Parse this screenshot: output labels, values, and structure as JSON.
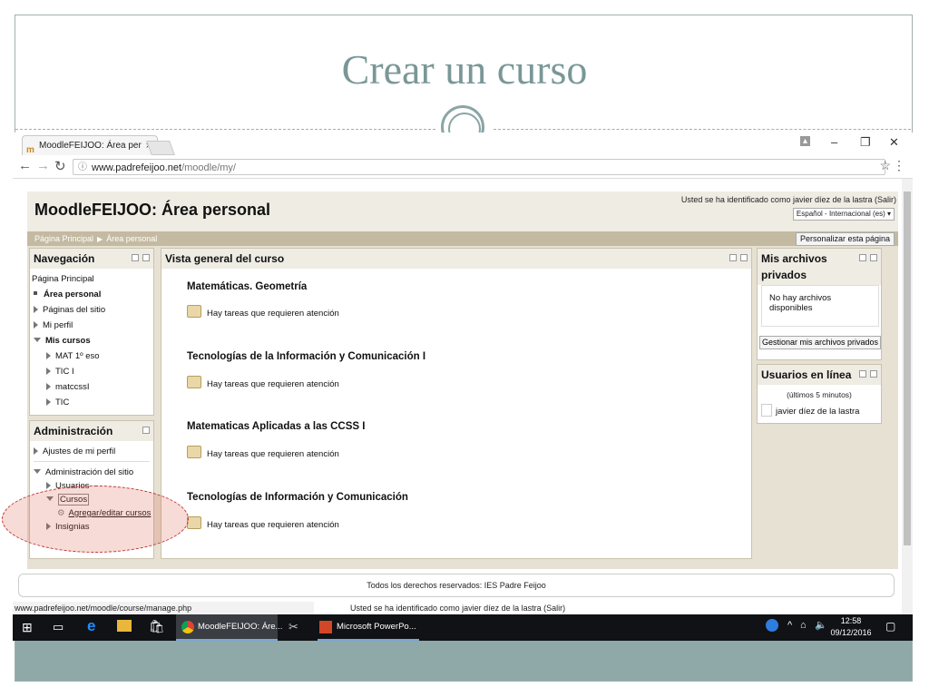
{
  "slide": {
    "title": "Crear un curso"
  },
  "browser": {
    "tab_title": "MoodleFEIJOO: Área per",
    "tab_close": "×",
    "url_host": "www.padrefeijoo.net",
    "url_path": "/moodle/my/",
    "status_url": "www.padrefeijoo.net/moodle/course/manage.php"
  },
  "moodle": {
    "site_title": "MoodleFEIJOO: Área personal",
    "login_info": "Usted se ha identificado como javier díez de la lastra (Salir)",
    "language": "Español - Internacional (es)",
    "breadcrumb": [
      "Página Principal",
      "Área personal"
    ],
    "edit_page_button": "Personalizar esta página",
    "navigation": {
      "title": "Navegación",
      "items": {
        "home": "Página Principal",
        "my_home": "Área personal",
        "site_pages": "Páginas del sitio",
        "profile": "Mi perfil",
        "my_courses": "Mis cursos",
        "courses": [
          "MAT 1º eso",
          "TIC I",
          "matccssI",
          "TIC"
        ]
      }
    },
    "administration": {
      "title": "Administración",
      "profile_settings": "Ajustes de mi perfil",
      "site_admin": "Administración del sitio",
      "users": "Usuarios",
      "courses": "Cursos",
      "add_edit_courses": "Agregar/editar cursos",
      "badges": "Insignias"
    },
    "course_overview": {
      "title": "Vista general del curso",
      "courses": [
        {
          "name": "Matemáticas. Geometría",
          "note": "Hay tareas que requieren atención"
        },
        {
          "name": "Tecnologías de la Información y Comunicación I",
          "note": "Hay tareas que requieren atención"
        },
        {
          "name": "Matematicas Aplicadas a las CCSS I",
          "note": "Hay tareas que requieren atención"
        },
        {
          "name": "Tecnologías de Información y Comunicación",
          "note": "Hay tareas que requieren atención"
        }
      ]
    },
    "private_files": {
      "title": "Mis archivos privados",
      "empty": "No hay archivos disponibles",
      "manage_button": "Gestionar mis archivos privados"
    },
    "online_users": {
      "title": "Usuarios en línea",
      "period": "(últimos 5 minutos)",
      "user": "javier díez de la lastra"
    },
    "footer": {
      "copyright": "Todos los derechos reservados: IES Padre Feijoo",
      "login_info": "Usted se ha identificado como javier díez de la lastra (Salir)"
    }
  },
  "taskbar": {
    "chrome_task": "MoodleFEIJOO: Áre...",
    "powerpoint_task": "Microsoft PowerPo...",
    "time": "12:58",
    "date": "09/12/2016"
  }
}
